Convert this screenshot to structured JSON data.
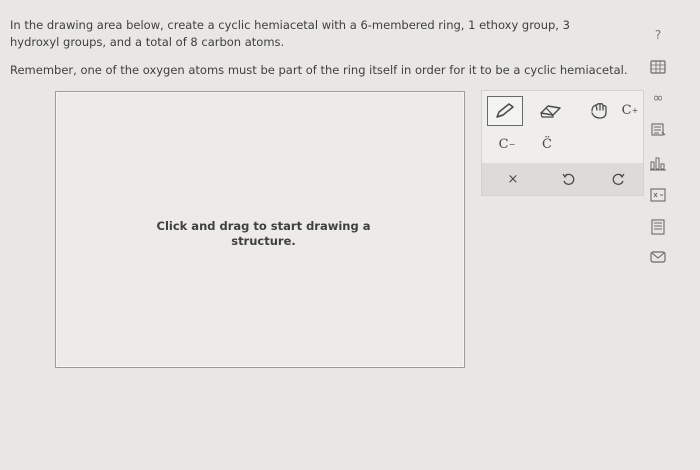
{
  "question": {
    "prompt": "In the drawing area below, create a cyclic hemiacetal with a 6-membered ring, 1 ethoxy group, 3 hydroxyl groups, and a total of 8 carbon atoms.",
    "reminder": "Remember, one of the oxygen atoms must be part of the ring itself in order for it to be a cyclic hemiacetal."
  },
  "canvas": {
    "hint": "Click and drag to start drawing a structure."
  },
  "toolbar": {
    "charge_label": "C",
    "charge_sup": "+",
    "carbanion_label": "C",
    "lonepair_label": "C̈",
    "clear_label": "×"
  },
  "sidebar": {
    "help_label": "?",
    "icons": [
      "help-icon",
      "periodic-table-icon",
      "infinity-icon",
      "notes-icon",
      "bar-chart-icon",
      "calculator-icon",
      "document-icon",
      "mail-icon"
    ]
  }
}
